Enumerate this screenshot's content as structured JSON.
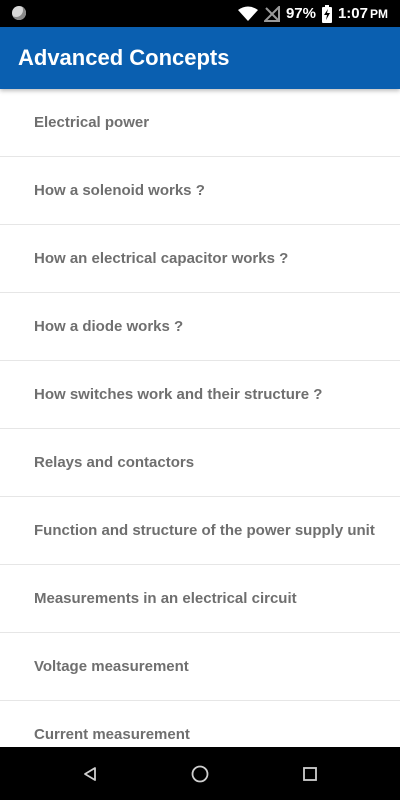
{
  "status_bar": {
    "battery": "97%",
    "time": "1:07",
    "ampm": "PM"
  },
  "app_bar": {
    "title": "Advanced Concepts"
  },
  "list": {
    "items": [
      {
        "label": "Electrical power"
      },
      {
        "label": "How a solenoid works ?"
      },
      {
        "label": "How an electrical capacitor works ?"
      },
      {
        "label": "How a diode works ?"
      },
      {
        "label": "How switches work and their structure ?"
      },
      {
        "label": "Relays and contactors"
      },
      {
        "label": "Function and structure of the power supply unit"
      },
      {
        "label": "Measurements in an electrical circuit"
      },
      {
        "label": "Voltage measurement"
      },
      {
        "label": "Current measurement"
      }
    ]
  },
  "nav_bar": {
    "icons": [
      "back-icon",
      "home-icon",
      "recents-icon"
    ]
  },
  "colors": {
    "app_bar": "#0a5fb0",
    "item_text": "#6f6f6f",
    "divider": "#e6e6e6"
  }
}
